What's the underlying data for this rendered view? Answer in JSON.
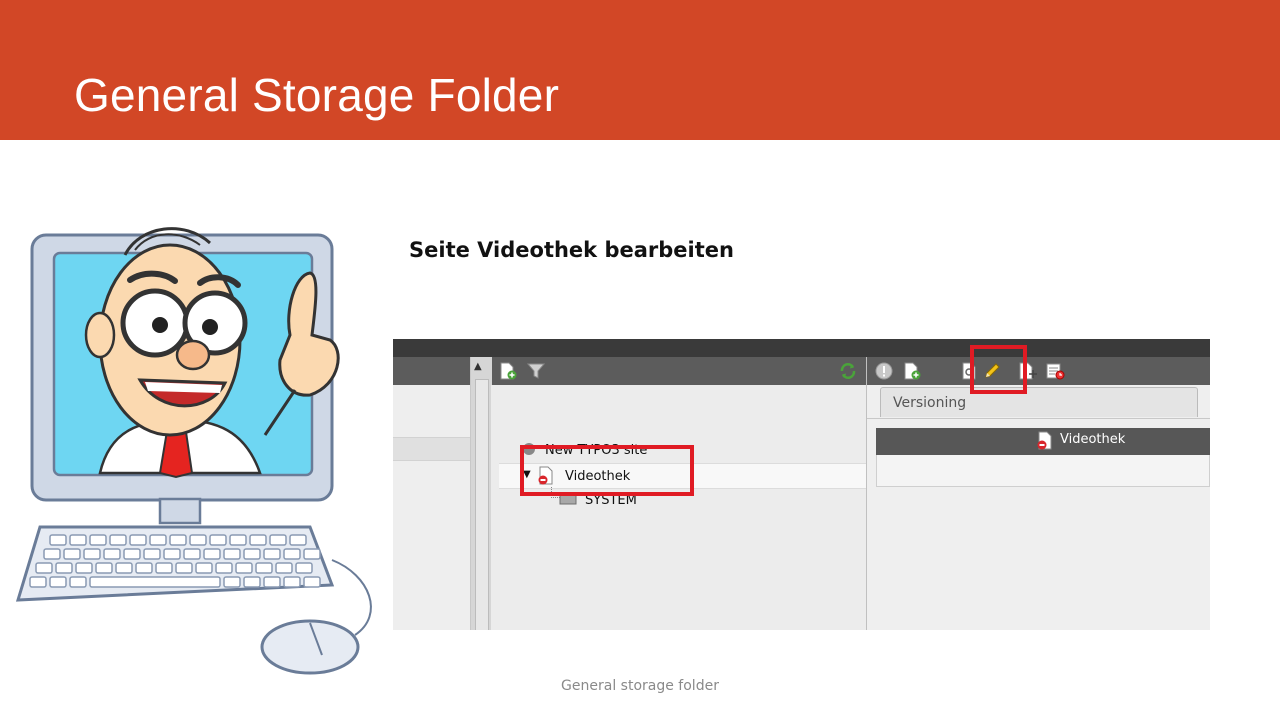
{
  "slide": {
    "title": "General Storage Folder",
    "subtitle": "Seite Videothek bearbeiten",
    "footer": "General storage folder",
    "accent_color": "#d24726",
    "highlight_color": "#e01b24"
  },
  "screenshot": {
    "tab_label": "Versioning",
    "tree": {
      "root_label": "New TYPO3 site",
      "selected_label": "Videothek",
      "child_label": "SYSTEM"
    },
    "page_header_label": "Videothek",
    "tree_toolbar_icons": [
      "new-page-icon",
      "filter-icon",
      "refresh-icon"
    ],
    "page_toolbar_icons": [
      "info-icon",
      "new-content-icon",
      "view-icon",
      "edit-pencil-icon",
      "move-icon",
      "history-icon"
    ]
  },
  "illustration": "cartoon-man-in-computer-monitor"
}
